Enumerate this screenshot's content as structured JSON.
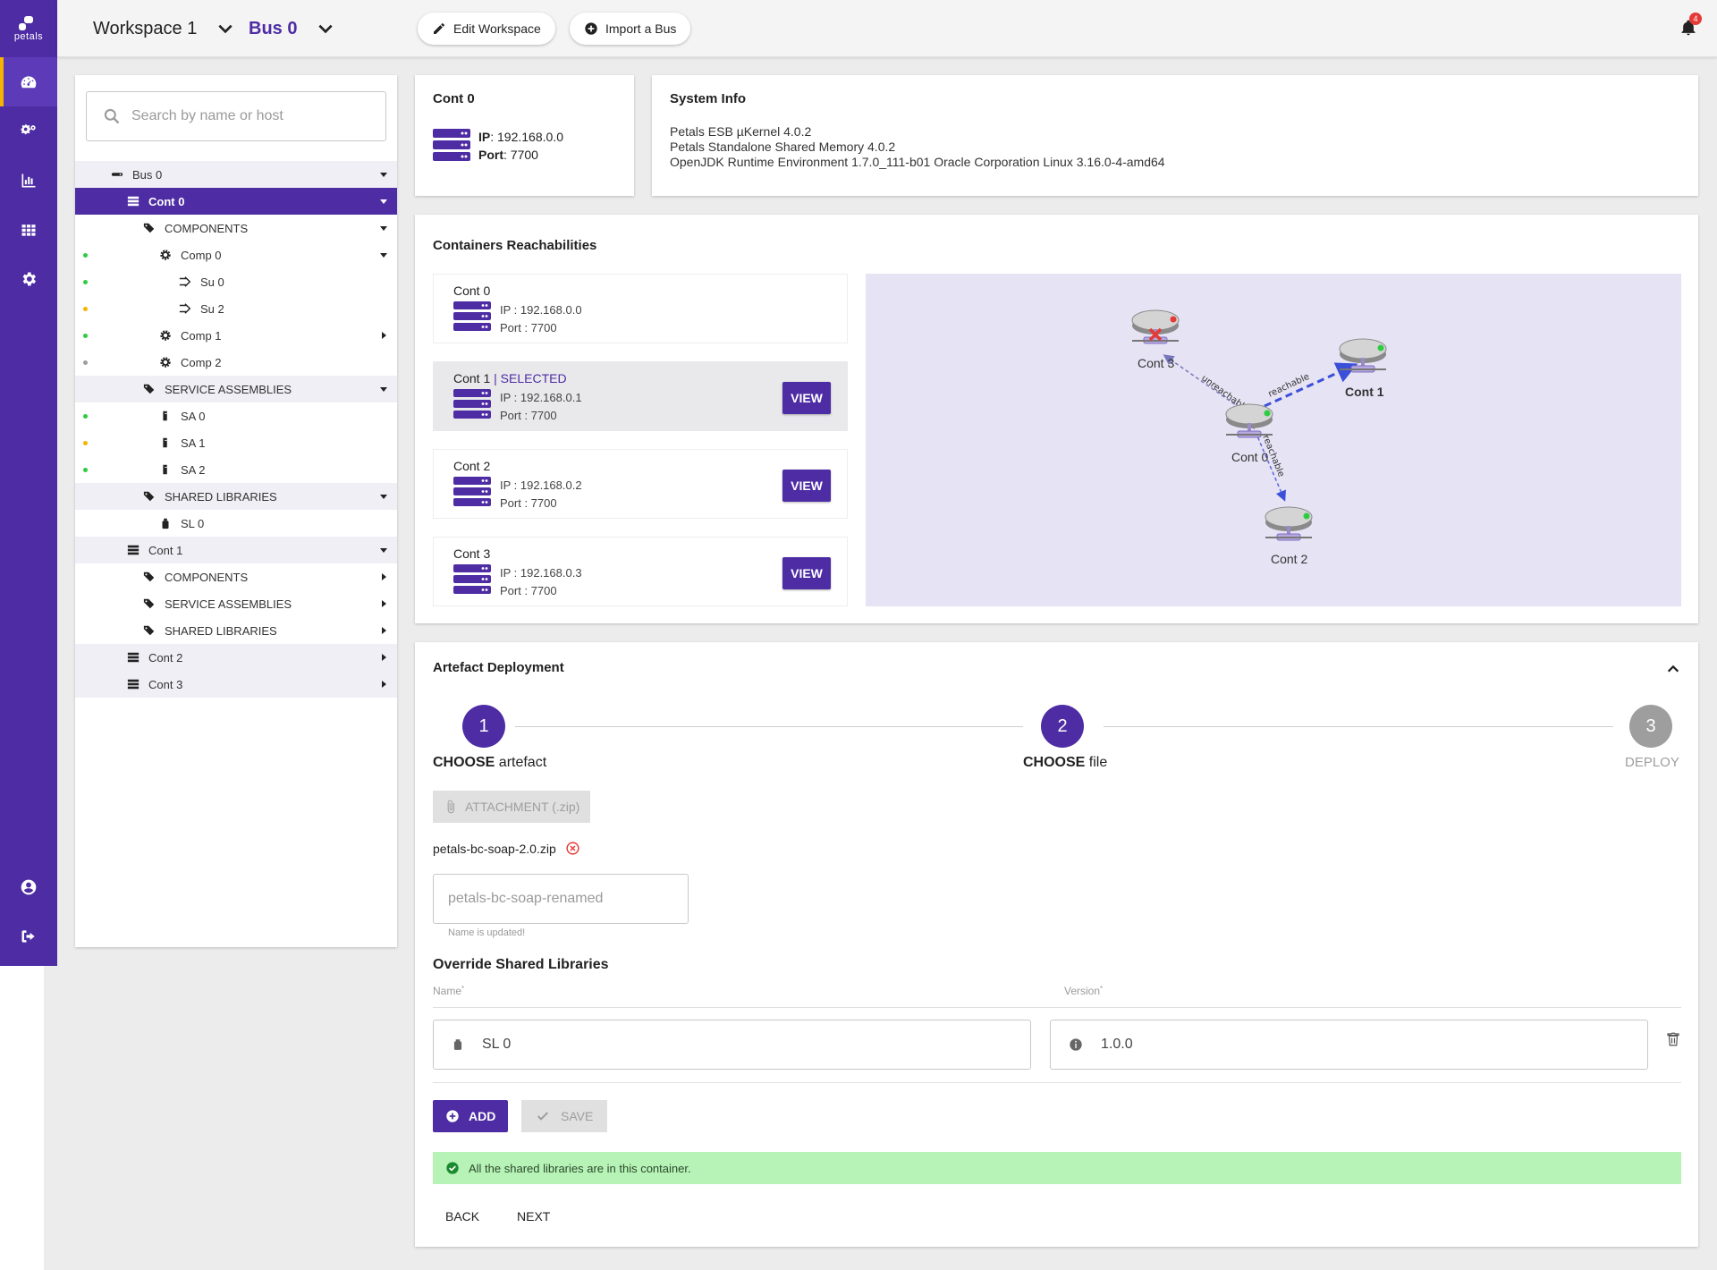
{
  "app": {
    "logo_text": "petals"
  },
  "colors": {
    "primary": "#4d2ca4",
    "accent": "#f4b400",
    "success_bg": "#b7f2b7",
    "dot_green": "#2ecc40",
    "dot_yellow": "#f4b400",
    "dot_grey": "#9e9e9e",
    "error": "#e53935"
  },
  "nav": {
    "items": [
      {
        "icon": "dashboard-icon",
        "active": true
      },
      {
        "icon": "gears-icon",
        "active": false
      },
      {
        "icon": "bar-chart-icon",
        "active": false
      },
      {
        "icon": "apps-grid-icon",
        "active": false
      },
      {
        "icon": "settings-icon",
        "active": false
      }
    ],
    "bottom": [
      {
        "icon": "account-icon"
      },
      {
        "icon": "logout-icon"
      }
    ]
  },
  "header": {
    "workspace": "Workspace 1",
    "bus": "Bus 0",
    "edit_workspace": "Edit Workspace",
    "import_bus": "Import a Bus",
    "notification_count": "4"
  },
  "tree": {
    "search_placeholder": "Search by name or host",
    "rows": [
      {
        "label": "Bus 0",
        "icon": "bus-icon",
        "indent": 0,
        "shade": true,
        "caret": "down"
      },
      {
        "label": "Cont 0",
        "icon": "server-icon",
        "indent": 1,
        "selected": true,
        "caret": "down"
      },
      {
        "label": "COMPONENTS",
        "icon": "tags-icon",
        "indent": 2,
        "caret": "down"
      },
      {
        "label": "Comp 0",
        "icon": "gear-icon",
        "indent": 3,
        "dot": "green",
        "caret": "down"
      },
      {
        "label": "Su 0",
        "icon": "su-icon",
        "indent": 4,
        "dot": "green"
      },
      {
        "label": "Su 2",
        "icon": "su-icon",
        "indent": 4,
        "dot": "yellow"
      },
      {
        "label": "Comp 1",
        "icon": "gear-icon",
        "indent": 3,
        "dot": "green",
        "caret": "right"
      },
      {
        "label": "Comp 2",
        "icon": "gear-icon",
        "indent": 3,
        "dot": "grey"
      },
      {
        "label": "SERVICE ASSEMBLIES",
        "icon": "tags-icon",
        "indent": 2,
        "shade": true,
        "caret": "down"
      },
      {
        "label": "SA 0",
        "icon": "sa-icon",
        "indent": 3,
        "dot": "green"
      },
      {
        "label": "SA 1",
        "icon": "sa-icon",
        "indent": 3,
        "dot": "yellow"
      },
      {
        "label": "SA 2",
        "icon": "sa-icon",
        "indent": 3,
        "dot": "green"
      },
      {
        "label": "SHARED LIBRARIES",
        "icon": "tags-icon",
        "indent": 2,
        "shade": true,
        "caret": "down"
      },
      {
        "label": "SL 0",
        "icon": "sl-icon",
        "indent": 3
      },
      {
        "label": "Cont 1",
        "icon": "server-icon",
        "indent": 1,
        "shade": true,
        "caret": "down"
      },
      {
        "label": "COMPONENTS",
        "icon": "tags-icon",
        "indent": 2,
        "caret": "right"
      },
      {
        "label": "SERVICE ASSEMBLIES",
        "icon": "tags-icon",
        "indent": 2,
        "caret": "right"
      },
      {
        "label": "SHARED LIBRARIES",
        "icon": "tags-icon",
        "indent": 2,
        "caret": "right"
      },
      {
        "label": "Cont 2",
        "icon": "server-icon",
        "indent": 1,
        "shade": true,
        "caret": "right"
      },
      {
        "label": "Cont 3",
        "icon": "server-icon",
        "indent": 1,
        "shade": true,
        "caret": "right"
      }
    ]
  },
  "cont_card": {
    "title": "Cont 0",
    "ip_label": "IP",
    "ip": "192.168.0.0",
    "port_label": "Port",
    "port": "7700"
  },
  "system_info": {
    "title": "System Info",
    "lines": [
      "Petals ESB µKernel 4.0.2",
      "Petals Standalone Shared Memory 4.0.2",
      "OpenJDK Runtime Environment 1.7.0_111-b01 Oracle Corporation Linux 3.16.0-4-amd64"
    ]
  },
  "reach": {
    "title": "Containers Reachabilities",
    "view_label": "VIEW",
    "selected_tag": "| SELECTED",
    "items": [
      {
        "name": "Cont 0",
        "ip": "IP : 192.168.0.0",
        "port": "Port : 7700",
        "selected": false,
        "view": false
      },
      {
        "name": "Cont 1",
        "ip": "IP : 192.168.0.1",
        "port": "Port : 7700",
        "selected": true,
        "view": true
      },
      {
        "name": "Cont 2",
        "ip": "IP : 192.168.0.2",
        "port": "Port : 7700",
        "selected": false,
        "view": true
      },
      {
        "name": "Cont 3",
        "ip": "IP : 192.168.0.3",
        "port": "Port : 7700",
        "selected": false,
        "view": true
      }
    ],
    "graph": {
      "nodes": [
        "Cont 3",
        "Cont 1",
        "Cont 0",
        "Cont 2"
      ],
      "edges": [
        {
          "from": "Cont 0",
          "to": "Cont 3",
          "label": "unreachable"
        },
        {
          "from": "Cont 0",
          "to": "Cont 1",
          "label": "reachable"
        },
        {
          "from": "Cont 0",
          "to": "Cont 2",
          "label": "reachable"
        }
      ]
    }
  },
  "deploy": {
    "title": "Artefact Deployment",
    "steps": [
      {
        "num": "1",
        "bold": "CHOOSE",
        "rest": " artefact",
        "state": "active"
      },
      {
        "num": "2",
        "bold": "CHOOSE",
        "rest": " file",
        "state": "active"
      },
      {
        "num": "3",
        "bold": "",
        "rest": "DEPLOY",
        "state": "inactive"
      }
    ],
    "attachment_label": "ATTACHMENT (.zip)",
    "file_name": "petals-bc-soap-2.0.zip",
    "rename_value": "petals-bc-soap-renamed",
    "rename_hint": "Name is updated!",
    "override_title": "Override Shared Libraries",
    "name_col": "Name",
    "version_col": "Version",
    "required_mark": "*",
    "sl_name": "SL 0",
    "sl_version": "1.0.0",
    "add_label": "ADD",
    "save_label": "SAVE",
    "success_msg": "All the shared libraries are in this container.",
    "back_label": "BACK",
    "next_label": "NEXT"
  }
}
